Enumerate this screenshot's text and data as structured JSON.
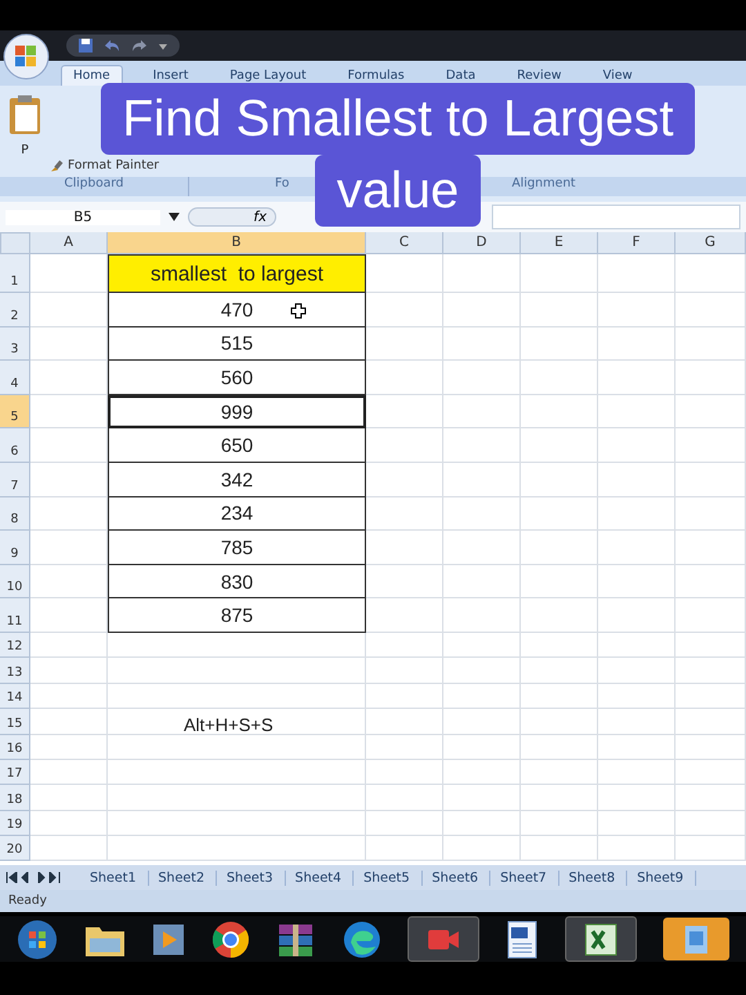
{
  "ribbon_tabs": [
    {
      "label": "Home",
      "selected": true
    },
    {
      "label": "Insert",
      "selected": false
    },
    {
      "label": "Page Layout",
      "selected": false
    },
    {
      "label": "Formulas",
      "selected": false
    },
    {
      "label": "Data",
      "selected": false
    },
    {
      "label": "Review",
      "selected": false
    },
    {
      "label": "View",
      "selected": false
    }
  ],
  "clipboard": {
    "paste_label": "P",
    "format_painter": "Format Painter"
  },
  "ribbon_groups": [
    {
      "label": "Clipboard"
    },
    {
      "label": "Fo"
    },
    {
      "label": "Alignment"
    }
  ],
  "name_box": "B5",
  "function_label": "fx",
  "columns": [
    {
      "label": "A",
      "selected": false
    },
    {
      "label": "B",
      "selected": true
    },
    {
      "label": "C",
      "selected": false
    },
    {
      "label": "D",
      "selected": false
    },
    {
      "label": "E",
      "selected": false
    },
    {
      "label": "F",
      "selected": false
    },
    {
      "label": "G",
      "selected": false
    }
  ],
  "rows": [
    {
      "number": "1",
      "selected": false,
      "kind": "header",
      "value": "smallest  to largest"
    },
    {
      "number": "2",
      "selected": false,
      "kind": "number",
      "value": "470"
    },
    {
      "number": "3",
      "selected": false,
      "kind": "number",
      "value": "515"
    },
    {
      "number": "4",
      "selected": false,
      "kind": "number",
      "value": "560"
    },
    {
      "number": "5",
      "selected": true,
      "kind": "number",
      "value": "999"
    },
    {
      "number": "6",
      "selected": false,
      "kind": "number",
      "value": "650"
    },
    {
      "number": "7",
      "selected": false,
      "kind": "number",
      "value": "342"
    },
    {
      "number": "8",
      "selected": false,
      "kind": "number",
      "value": "234"
    },
    {
      "number": "9",
      "selected": false,
      "kind": "number",
      "value": "785"
    },
    {
      "number": "10",
      "selected": false,
      "kind": "number",
      "value": "830"
    },
    {
      "number": "11",
      "selected": false,
      "kind": "number",
      "value": "875"
    },
    {
      "number": "12",
      "selected": false,
      "kind": "empty"
    },
    {
      "number": "13",
      "selected": false,
      "kind": "empty"
    },
    {
      "number": "14",
      "selected": false,
      "kind": "empty"
    },
    {
      "number": "15",
      "selected": false,
      "kind": "empty"
    },
    {
      "number": "16",
      "selected": false,
      "kind": "empty"
    },
    {
      "number": "17",
      "selected": false,
      "kind": "empty"
    },
    {
      "number": "18",
      "selected": false,
      "kind": "empty"
    },
    {
      "number": "19",
      "selected": false,
      "kind": "empty"
    },
    {
      "number": "20",
      "selected": false,
      "kind": "empty"
    }
  ],
  "shortcut_hint": "Alt+H+S+S",
  "sheet_tabs": [
    "Sheet1",
    "Sheet2",
    "Sheet3",
    "Sheet4",
    "Sheet5",
    "Sheet6",
    "Sheet7",
    "Sheet8",
    "Sheet9"
  ],
  "status_bar": "Ready",
  "caption": [
    "Find Smallest to Largest",
    "value"
  ]
}
